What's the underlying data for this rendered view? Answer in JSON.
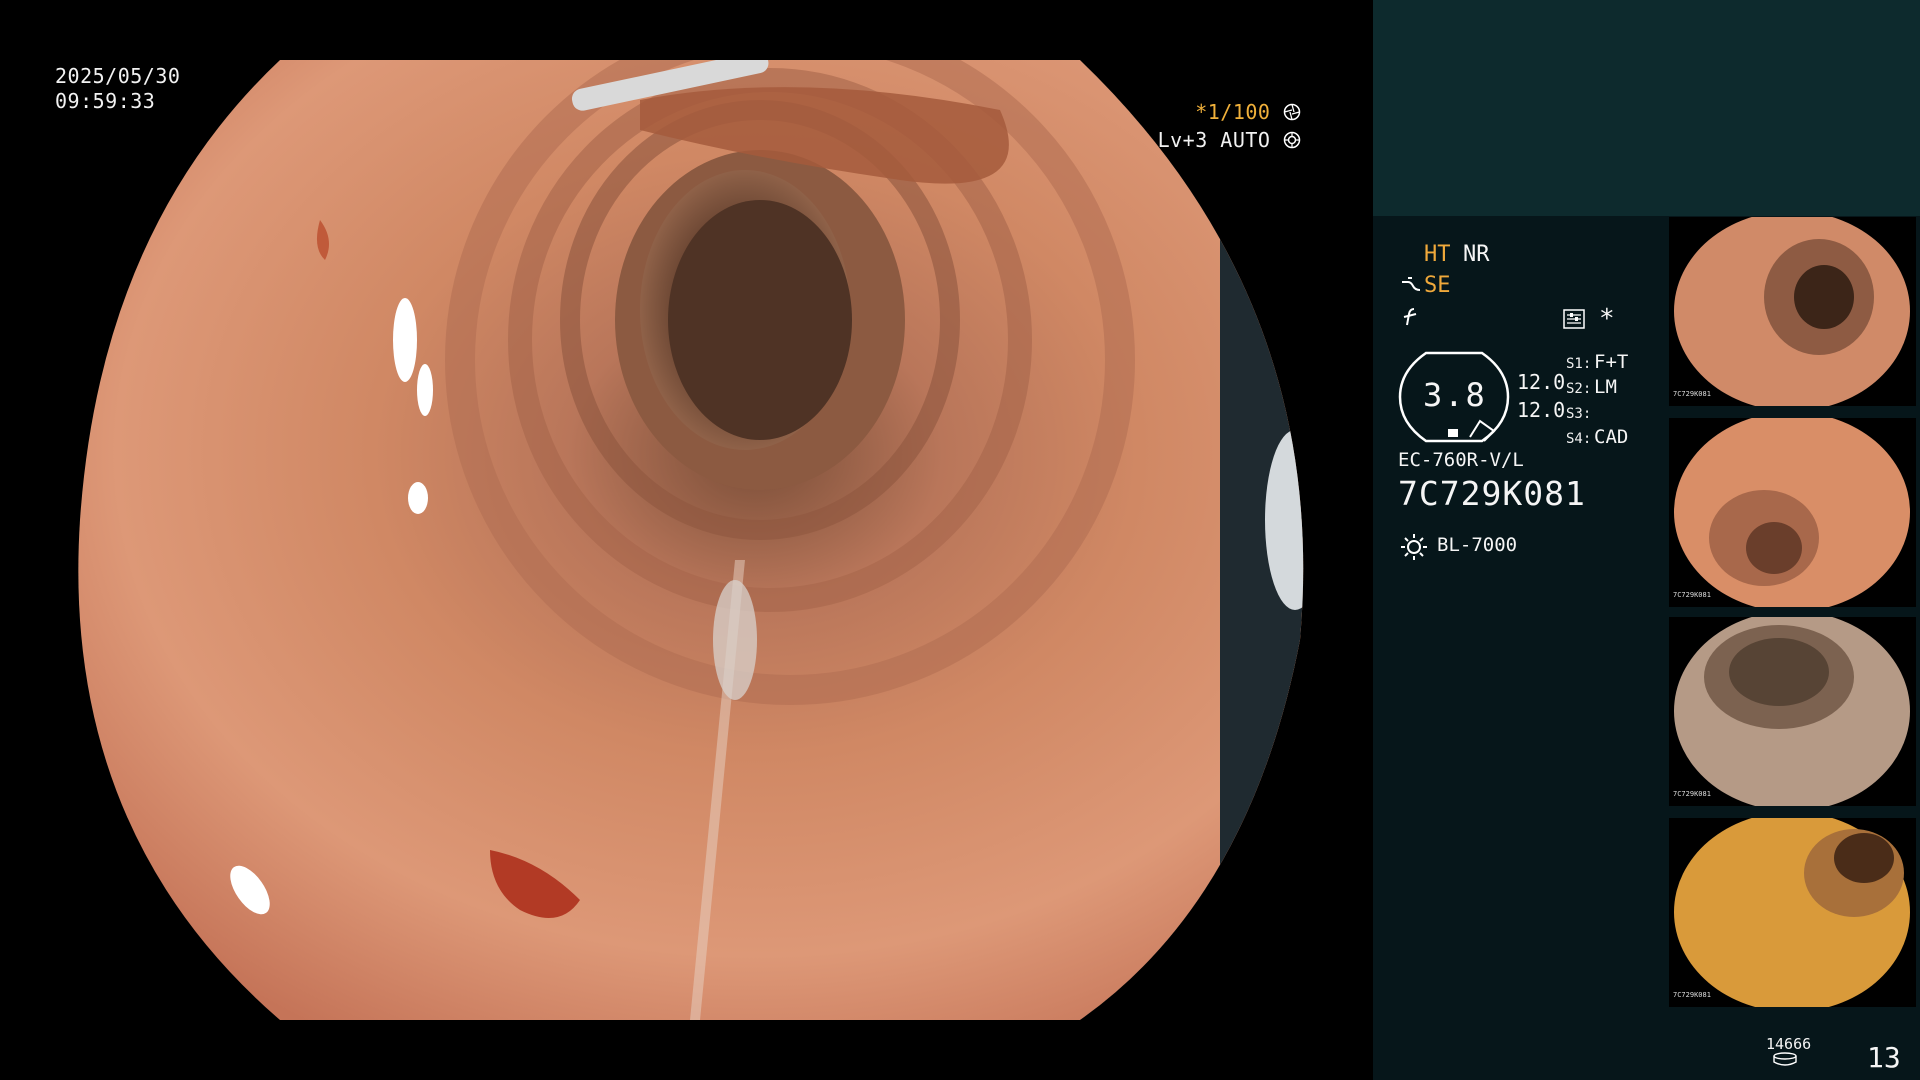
{
  "osd": {
    "date": "2025/05/30",
    "time": "09:59:33",
    "shutter_prefix": "*",
    "shutter_value": "1/100",
    "shutter_icon": "aperture-icon",
    "level": "Lv+3 AUTO",
    "level_icon": "iris-icon"
  },
  "panel": {
    "mode_ht": "HT",
    "mode_nr": "NR",
    "mode_se": "SE",
    "mode_se_icon": "enhance-curve-icon",
    "mode_f_icon": "sharpness-icon",
    "menu_icon": "settings-list-icon",
    "star": "*",
    "gauge_value": "3.8",
    "value_a": "12.0",
    "value_b": "12.0",
    "slots": [
      {
        "key": "S1:",
        "value": "F+T"
      },
      {
        "key": "S2:",
        "value": "LM"
      },
      {
        "key": "S3:",
        "value": ""
      },
      {
        "key": "S4:",
        "value": "CAD"
      }
    ],
    "scope_model": "EC-760R-V/L",
    "scope_serial": "7C729K081",
    "light_icon": "sun-icon",
    "light_source": "BL-7000",
    "thumb_label": "7C729K081",
    "count_small": "14666",
    "count_big": "13"
  },
  "colors": {
    "accent_orange": "#f0a93b",
    "panel_bg": "#06161a",
    "panel_top": "#0d2a2d",
    "mucosa": "#d98a66",
    "lumen": "#5a3a2a"
  }
}
